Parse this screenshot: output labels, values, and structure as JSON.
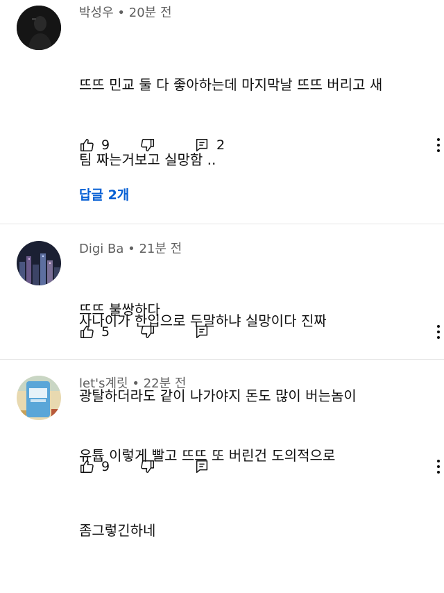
{
  "comments": [
    {
      "author": "박성우",
      "dot": "•",
      "time": "20분 전",
      "lines": [
        "뜨뜨 민교 둘 다 좋아하는데 마지막날 뜨뜨 버리고 새",
        "팀 짜는거보고 실망함 ..",
        "",
        "뜨뜨 불쌍하다"
      ],
      "likes": "9",
      "replies_count": "2",
      "replies_link": "답글 2개"
    },
    {
      "author": "Digi Ba",
      "dot": "•",
      "time": "21분 전",
      "lines": [
        "사나이가 한입으로 두말하냐 실망이다 진짜",
        "광탈하더라도 같이 나가야지 돈도 많이 버는놈이"
      ],
      "likes": "5",
      "replies_count": ""
    },
    {
      "author": "let's계릿",
      "dot": "•",
      "time": "22분 전",
      "lines": [
        "유튭 이렇게 빨고 뜨뜨 또 버린건 도의적으로",
        "좀그렇긴하네"
      ],
      "likes": "9",
      "replies_count": ""
    }
  ],
  "colors": {
    "meta": "#606060",
    "link": "#065fd4",
    "divider": "#e5e5e5"
  },
  "icons": [
    "thumb-up-icon",
    "thumb-down-icon",
    "reply-comment-icon",
    "more-vert-icon"
  ]
}
